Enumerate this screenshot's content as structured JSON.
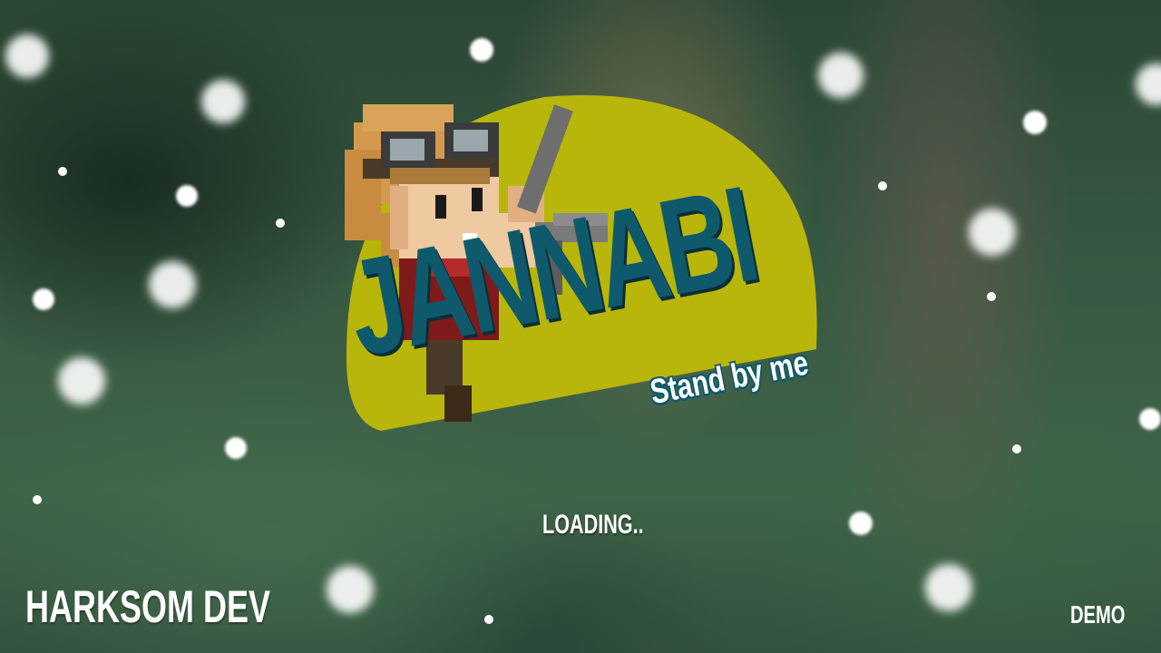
{
  "game": {
    "title": "JANNABI",
    "subtitle": "Stand by me",
    "status": "LOADING..",
    "developer": "HARKSOM DEV",
    "build": "DEMO"
  },
  "icons": {
    "character": "pixel-explorer-with-goggles-and-pickaxe-icon"
  },
  "colors": {
    "title": "#0e5a6c",
    "sun": "#b8b60a",
    "text": "#ffffff"
  }
}
